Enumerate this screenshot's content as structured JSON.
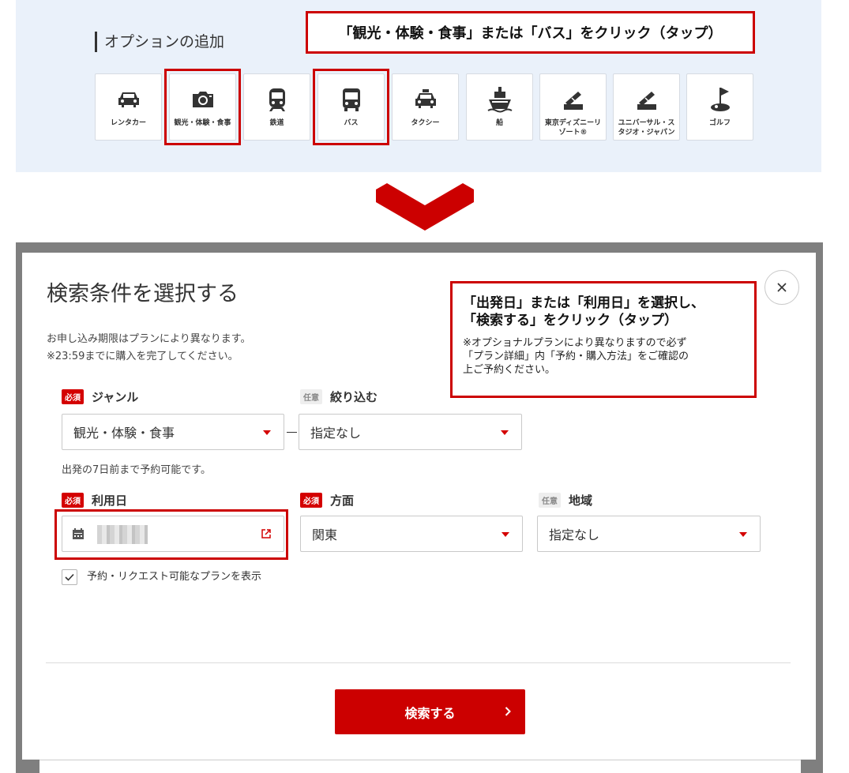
{
  "top": {
    "section_title": "オプションの追加",
    "instruction": "「観光・体験・食事」または「バス」をクリック（タップ）",
    "tiles": [
      {
        "label": "レンタカー",
        "icon": "car-icon"
      },
      {
        "label": "観光・体験・食事",
        "icon": "camera-icon"
      },
      {
        "label": "鉄道",
        "icon": "train-icon"
      },
      {
        "label": "バス",
        "icon": "bus-icon"
      },
      {
        "label": "タクシー",
        "icon": "taxi-icon"
      },
      {
        "label": "船",
        "icon": "ship-icon"
      },
      {
        "label": "東京ディズニーリゾート®",
        "icon": "ticket-icon"
      },
      {
        "label": "ユニバーサル・スタジオ・ジャパン",
        "icon": "ticket-icon"
      },
      {
        "label": "ゴルフ",
        "icon": "golf-icon"
      }
    ]
  },
  "modal": {
    "title": "検索条件を選択する",
    "note1": "お申し込み期限はプランにより異なります。",
    "note2": "※23:59までに購入を完了してください。",
    "instruction_head1": "「出発日」または「利用日」を選択し、",
    "instruction_head2": "「検索する」をクリック（タップ）",
    "instruction_body1": "※オプショナルプランにより異なりますので必ず",
    "instruction_body2": "「プラン詳細」内「予約・購入方法」をご確認の",
    "instruction_body3": "上ご予約ください。",
    "badge_required": "必須",
    "badge_optional": "任意",
    "genre_label": "ジャンル",
    "genre_value": "観光・体験・食事",
    "filter_label": "絞り込む",
    "filter_value": "指定なし",
    "advance_note": "出発の7日前まで予約可能です。",
    "date_label": "利用日",
    "direction_label": "方面",
    "direction_value": "関東",
    "area_label": "地域",
    "area_value": "指定なし",
    "checkbox_label": "予約・リクエスト可能なプランを表示",
    "checkbox_checked": true,
    "search_button": "検索する"
  },
  "colors": {
    "accent": "#cc0000",
    "panel_bg": "#eaf1fa",
    "backdrop": "#7f7f7f"
  }
}
